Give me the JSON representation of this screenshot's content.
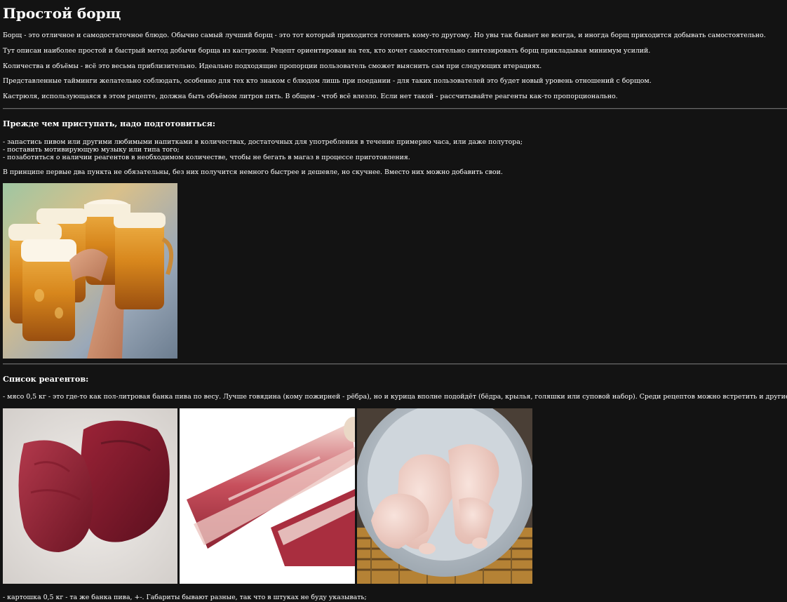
{
  "title": "Простой борщ",
  "intro": [
    "Борщ - это отличное и самодостаточное блюдо. Обычно самый лучший борщ - это тот который приходится готовить кому-то другому. Но увы так бывает не всегда, и иногда борщ приходится добывать самостоятельно.",
    "Тут описан наиболее простой и быстрый метод добычи борща из кастрюли. Рецепт ориентирован на тех, кто хочет самостоятельно синтезировать борщ прикладывая минимум усилий.",
    "Количества и объёмы - всё это весьма приблизительно. Идеально подходящие пропорции пользователь сможет выяснить сам при следующих итерациях.",
    "Представленные тайминги желательно соблюдать, особенно для тех кто знаком с блюдом лишь при поедании - для таких пользователей это будет новый уровень отношений с борщом.",
    "Кастрюля, использующаяся в этом рецепте, должна быть объёмом литров пять. В общем - чтоб всё влезло. Если нет такой - рассчитывайте реагенты как-то пропорционально."
  ],
  "prep": {
    "heading": "Прежде чем приступать, надо подготовиться:",
    "items": [
      "- запастись пивом или другими любимыми напитками в количествах, достаточных для употребления в течение примерно часа, или даже полутора;",
      "- поставить мотивирующую музыку или типа того;",
      "- позаботиться о наличии реагентов в необходимом количестве, чтобы не бегать в магаз в процессе приготовления."
    ],
    "note": "В принципе первые два пункта не обязательны, без них получится немного быстрее и дешевле, но скучнее. Вместо них можно добавить свои."
  },
  "reagents": {
    "heading": "Список реагентов:",
    "meat": "- мясо 0,5 кг - это где-то как пол-литровая банка пива по весу. Лучше говядина (кому пожирней - рёбра), но и курица вполне подойдёт (бёдра, крылья, голяшки или суповой набор). Среди рецептов можно встретить и другие виды мяса, и даже рыбу",
    "potato": "- картошка 0,5 кг - та же банка пива, +-. Габариты бывают разные, так что в штуках не буду указывать;"
  },
  "images": {
    "beer": "beer-mugs-photo",
    "beef": "beef-photo",
    "ribs": "beef-ribs-photo",
    "chicken": "chicken-drumsticks-photo"
  },
  "colors": {
    "background": "#131313",
    "text": "#ffffff",
    "rule": "#6a6a6a"
  }
}
